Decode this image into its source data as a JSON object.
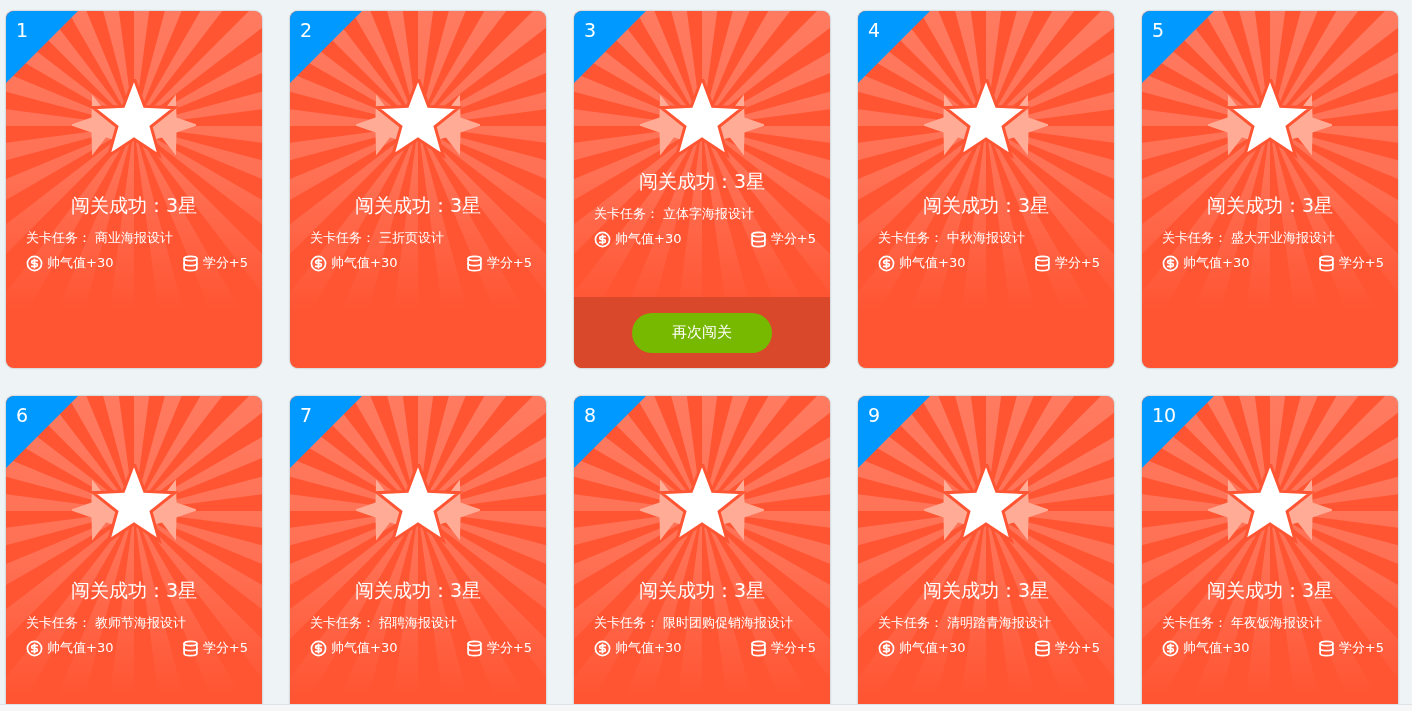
{
  "cards": [
    {
      "number": "1",
      "title": "闯关成功：3星",
      "task": "关卡任务： 商业海报设计",
      "charm": "帅气值+30",
      "credit": "学分+5",
      "hovered": false
    },
    {
      "number": "2",
      "title": "闯关成功：3星",
      "task": "关卡任务： 三折页设计",
      "charm": "帅气值+30",
      "credit": "学分+5",
      "hovered": false
    },
    {
      "number": "3",
      "title": "闯关成功：3星",
      "task": "关卡任务： 立体字海报设计",
      "charm": "帅气值+30",
      "credit": "学分+5",
      "hovered": true,
      "button": "再次闯关"
    },
    {
      "number": "4",
      "title": "闯关成功：3星",
      "task": "关卡任务： 中秋海报设计",
      "charm": "帅气值+30",
      "credit": "学分+5",
      "hovered": false
    },
    {
      "number": "5",
      "title": "闯关成功：3星",
      "task": "关卡任务： 盛大开业海报设计",
      "charm": "帅气值+30",
      "credit": "学分+5",
      "hovered": false
    },
    {
      "number": "6",
      "title": "闯关成功：3星",
      "task": "关卡任务： 教师节海报设计",
      "charm": "帅气值+30",
      "credit": "学分+5",
      "hovered": false
    },
    {
      "number": "7",
      "title": "闯关成功：3星",
      "task": "关卡任务： 招聘海报设计",
      "charm": "帅气值+30",
      "credit": "学分+5",
      "hovered": false
    },
    {
      "number": "8",
      "title": "闯关成功：3星",
      "task": "关卡任务： 限时团购促销海报设计",
      "charm": "帅气值+30",
      "credit": "学分+5",
      "hovered": false
    },
    {
      "number": "9",
      "title": "闯关成功：3星",
      "task": "关卡任务： 清明踏青海报设计",
      "charm": "帅气值+30",
      "credit": "学分+5",
      "hovered": false
    },
    {
      "number": "10",
      "title": "闯关成功：3星",
      "task": "关卡任务： 年夜饭海报设计",
      "charm": "帅气值+30",
      "credit": "学分+5",
      "hovered": false
    }
  ]
}
